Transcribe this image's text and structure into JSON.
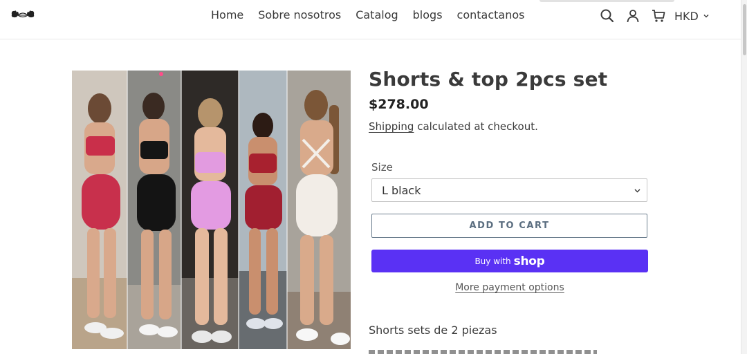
{
  "nav": {
    "items": [
      "Home",
      "Sobre nosotros",
      "Catalog",
      "blogs",
      "contactanos"
    ]
  },
  "header": {
    "icons": [
      "search-icon",
      "account-icon",
      "cart-icon"
    ],
    "currency": "HKD"
  },
  "product": {
    "title": "Shorts & top 2pcs set",
    "price": "$278.00",
    "shipping_link": "Shipping",
    "shipping_text": " calculated at checkout.",
    "size_label": "Size",
    "size_selected": "L black",
    "add_to_cart": "ADD TO CART",
    "buy_with": "Buy with",
    "shop_word": "shop",
    "more_payment": "More payment options",
    "description": "Shorts sets de 2 piezas",
    "image_color_variants": [
      "red",
      "black",
      "pink",
      "burgundy",
      "white"
    ]
  },
  "colors": {
    "accent_shop": "#5a31f4",
    "add_to_cart_text": "#5b6e80",
    "text": "#3a3a3a"
  }
}
